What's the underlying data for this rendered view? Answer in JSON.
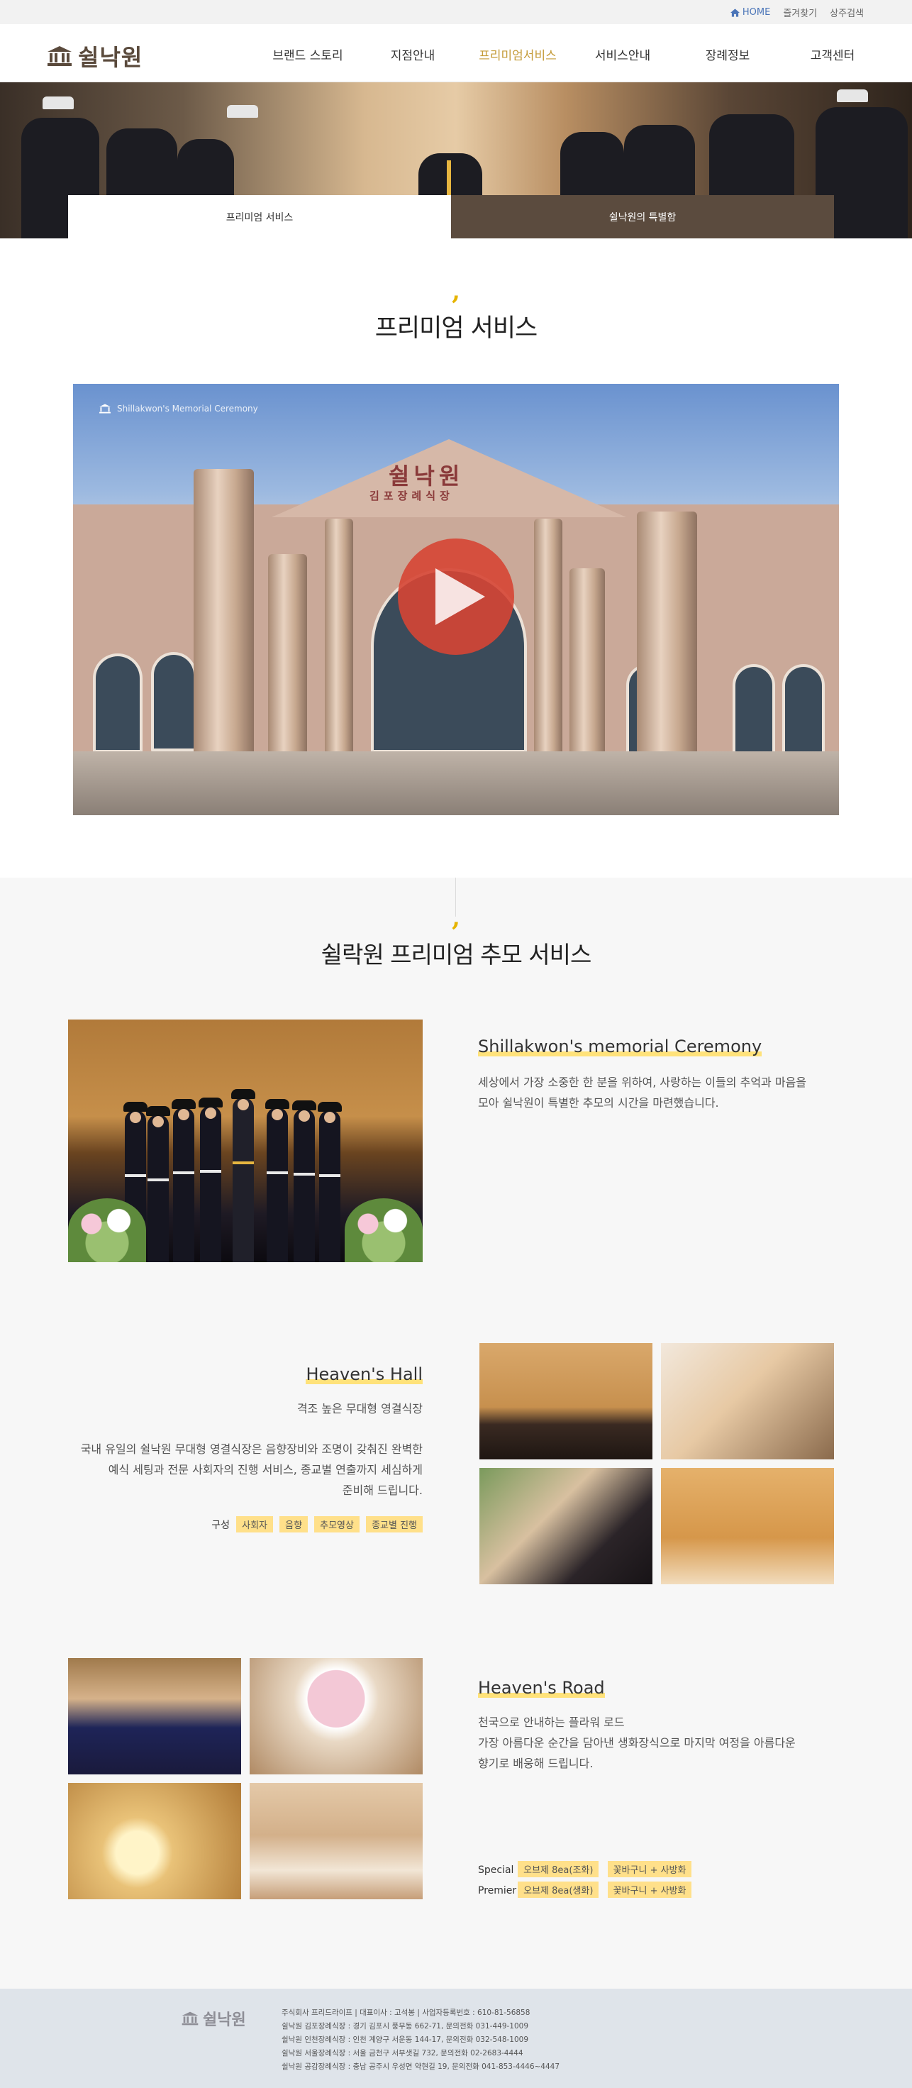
{
  "topbar": {
    "home": "HOME",
    "favorites": "즐겨찾기",
    "search": "상주검색"
  },
  "brand": {
    "name": "쉴낙원"
  },
  "nav": {
    "items": [
      "브랜드 스토리",
      "지점안내",
      "프리미엄서비스",
      "서비스안내",
      "장례정보",
      "고객센터"
    ],
    "active": "프리미엄서비스"
  },
  "subtabs": {
    "tab1": "프리미엄 서비스",
    "tab2": "쉴낙원의 특별함"
  },
  "section1": {
    "comma": ",",
    "title": "프리미엄 서비스",
    "video": {
      "watermark": "Shillakwon's Memorial Ceremony",
      "sign_main": "쉴낙원",
      "sign_sub": "김포장례식장"
    }
  },
  "section2": {
    "comma": ",",
    "title": "쉴락원 프리미엄 추모 서비스",
    "ceremony": {
      "title": "Shillakwon's memorial Ceremony",
      "desc1": "세상에서 가장 소중한 한 분을 위하여, 사랑하는 이들의 추억과 마음을",
      "desc2": "모아 쉴낙원이 특별한 추모의 시간을 마련했습니다."
    },
    "hall": {
      "title": "Heaven's Hall",
      "subtitle": "격조 높은 무대형 영결식장",
      "desc1": "국내 유일의 쉴낙원 무대형 영결식장은 음향장비와 조명이 갖춰진 완벽한",
      "desc2": "예식 세팅과 전문 사회자의 진행 서비스, 종교별 연출까지 세심하게",
      "desc3": "준비해 드립니다.",
      "tags_label": "구성",
      "tags": [
        "사회자",
        "음향",
        "추모영상",
        "종교별 진행"
      ]
    },
    "road": {
      "title": "Heaven's Road",
      "desc1": "천국으로 안내하는 플라워 로드",
      "desc2": "가장 아름다운 순간을 담아낸 생화장식으로 마지막 여정을 아름다운",
      "desc3": "향기로 배웅해 드립니다.",
      "special_label": "Special",
      "special_tags": [
        "오브제 8ea(조화)",
        "꽃바구니 + 사방화"
      ],
      "premier_label": "Premier",
      "premier_tags": [
        "오브제 8ea(생화)",
        "꽃바구니 + 사방화"
      ]
    }
  },
  "footer": {
    "brand": "쉴낙원",
    "lines": [
      "주식회사 프리드라이프   |   대표이사 : 고석봉   |   사업자등록번호 : 610-81-56858",
      "쉴낙원 김포장례식장 :  경기 김포시 풍무동 662-71,  문의전화 031-449-1009",
      "쉴낙원 인천장례식장 :  인천 계양구 서운동 144-17,  문의전화 032-548-1009",
      "쉴낙원 서울장례식장 :  서울 금천구 서부샛길 732,  문의전화 02-2683-4444",
      "쉴낙원 공감장례식장 :  충남 공주시 우성면 약현길 19,  문의전화 041-853-4446~4447"
    ]
  },
  "colors": {
    "accent": "#c49b38",
    "brand_brown": "#5b4b3e",
    "highlight": "#ffe27a",
    "comma": "#e6b400",
    "play": "#d64534"
  },
  "icons": [
    "home-icon",
    "building-logo-icon",
    "play-icon"
  ]
}
